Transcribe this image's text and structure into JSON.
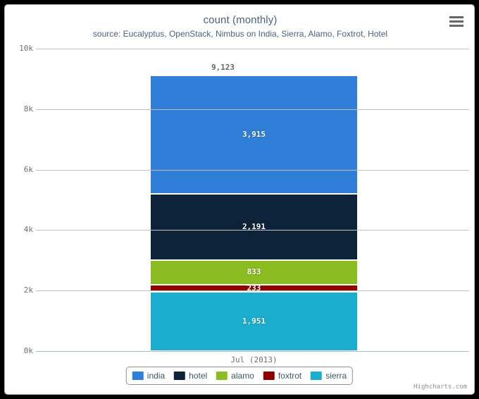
{
  "chart_data": {
    "type": "bar",
    "stacked": true,
    "title": "count (monthly)",
    "subtitle": "source: Eucalyptus, OpenStack, Nimbus on India, Sierra, Alamo, Foxtrot, Hotel",
    "xlabel": "",
    "ylabel": "",
    "categories": [
      "Jul (2013)"
    ],
    "ylim": [
      0,
      10000
    ],
    "yticks": [
      0,
      2000,
      4000,
      6000,
      8000,
      10000
    ],
    "ytick_labels": [
      "0k",
      "2k",
      "4k",
      "6k",
      "8k",
      "10k"
    ],
    "grid": true,
    "legend_position": "bottom",
    "total_label": "9,123",
    "total_value": 9123,
    "series": [
      {
        "name": "india",
        "values": [
          3915
        ],
        "label": "3,915",
        "color": "#2f7ed8"
      },
      {
        "name": "hotel",
        "values": [
          2191
        ],
        "label": "2,191",
        "color": "#0d233a"
      },
      {
        "name": "alamo",
        "values": [
          833
        ],
        "label": "833",
        "color": "#8bbc21"
      },
      {
        "name": "foxtrot",
        "values": [
          233
        ],
        "label": "233",
        "color": "#910000"
      },
      {
        "name": "sierra",
        "values": [
          1951
        ],
        "label": "1,951",
        "color": "#1aadce"
      }
    ],
    "stack_order_bottom_to_top": [
      "sierra",
      "foxtrot",
      "alamo",
      "hotel",
      "india"
    ]
  },
  "header": {
    "title": "count (monthly)",
    "subtitle": "source: Eucalyptus, OpenStack, Nimbus on India, Sierra, Alamo, Foxtrot, Hotel",
    "menu_icon": "hamburger-menu-icon"
  },
  "yaxis": {
    "labels": [
      "10k",
      "8k",
      "6k",
      "4k",
      "2k",
      "0k"
    ]
  },
  "xaxis": {
    "labels": [
      "Jul (2013)"
    ]
  },
  "bars": {
    "total": "9,123",
    "segments": [
      {
        "label": "3,915",
        "name": "india"
      },
      {
        "label": "2,191",
        "name": "hotel"
      },
      {
        "label": "833",
        "name": "alamo"
      },
      {
        "label": "233",
        "name": "foxtrot"
      },
      {
        "label": "1,951",
        "name": "sierra"
      }
    ]
  },
  "legend": {
    "items": [
      {
        "label": "india",
        "color": "#2f7ed8"
      },
      {
        "label": "hotel",
        "color": "#0d233a"
      },
      {
        "label": "alamo",
        "color": "#8bbc21"
      },
      {
        "label": "foxtrot",
        "color": "#910000"
      },
      {
        "label": "sierra",
        "color": "#1aadce"
      }
    ]
  },
  "credit": {
    "text": "Highcharts.com"
  },
  "colors": {
    "title": "#4d6182",
    "axis_text": "#707070",
    "gridline": "#c0c0c0",
    "axisline": "#a7c2d2",
    "legend_text": "#3e576f",
    "background": "#ffffff"
  }
}
